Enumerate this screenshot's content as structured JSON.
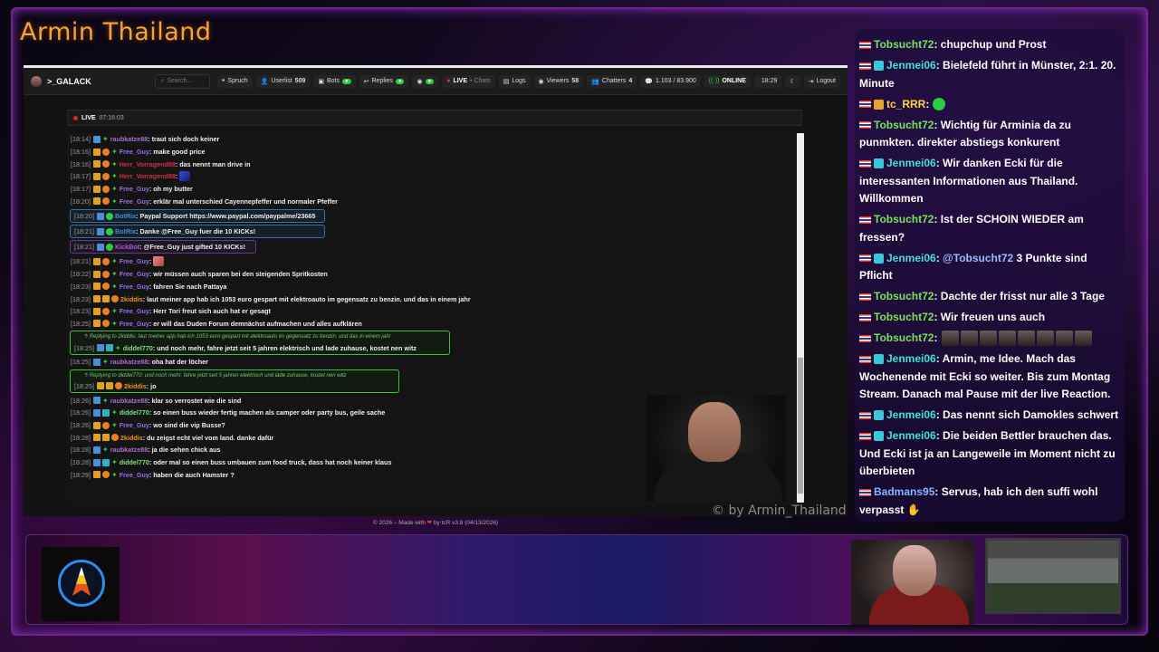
{
  "channel_title": "Armin Thailand",
  "app": {
    "brand": ">_GALACK",
    "search_placeholder": "Search...",
    "toolbar": [
      {
        "icon": "quote-icon",
        "label": "Spruch"
      },
      {
        "icon": "user-icon",
        "label": "Userlist",
        "count": "509"
      },
      {
        "icon": "robot-icon",
        "label": "Bots",
        "pill": "on"
      },
      {
        "icon": "reply-icon",
        "label": "Replies",
        "pill": "on"
      },
      {
        "icon": "ghost-icon",
        "label": "",
        "pill": "on"
      },
      {
        "icon": "live-dot-icon",
        "label": "LIVE",
        "sub": "• Chats"
      },
      {
        "icon": "file-icon",
        "label": "Logs"
      },
      {
        "icon": "eye-icon",
        "label": "Viewers",
        "count": "58"
      },
      {
        "icon": "users-icon",
        "label": "Chatters",
        "count": "4"
      },
      {
        "icon": "chat-icon",
        "label": "1.103 / 83.900"
      },
      {
        "icon": "signal-icon",
        "label": "ONLINE"
      },
      {
        "icon": "clock-icon",
        "label": "18:29"
      },
      {
        "icon": "moon-icon",
        "label": ""
      },
      {
        "icon": "logout-icon",
        "label": "Logout"
      }
    ],
    "live_label": "LIVE",
    "live_time": "07:16:03",
    "footer": "© 2026 – Made with",
    "footer_by": "by tcR",
    "footer_version": "v3.8 (04/13/2026)"
  },
  "messages": [
    {
      "t": "[18:14]",
      "user": "raubkatze88",
      "cls": "u-raub",
      "badges": [
        "blue",
        "green"
      ],
      "text": ": traut sich doch keiner"
    },
    {
      "t": "[18:16]",
      "user": "Free_Guy",
      "cls": "u-free",
      "badges": [
        "gold",
        "org",
        "green"
      ],
      "text": ": make good price"
    },
    {
      "t": "[18:16]",
      "user": "Herr_Vorragend88",
      "cls": "u-herr",
      "badges": [
        "gold",
        "org",
        "green"
      ],
      "text": ": das nennt man drive in"
    },
    {
      "t": "[18:17]",
      "user": "Herr_Vorragend88",
      "cls": "u-herr",
      "badges": [
        "gold",
        "org",
        "green"
      ],
      "text": ":",
      "emote": "blue"
    },
    {
      "t": "[18:17]",
      "user": "Free_Guy",
      "cls": "u-free",
      "badges": [
        "gold",
        "org",
        "green"
      ],
      "text": ": oh my butter"
    },
    {
      "t": "[18:20]",
      "user": "Free_Guy",
      "cls": "u-free",
      "badges": [
        "gold",
        "org",
        "green"
      ],
      "text": ": erklär mal unterschied Cayennepfeffer und normaler Pfeffer"
    },
    {
      "t": "[18:20]",
      "user": "BotRix",
      "cls": "u-bot",
      "badges": [
        "blue",
        "bot"
      ],
      "text": ": Paypal Support https://www.paypal.com/paypalme/23665",
      "box": "bot"
    },
    {
      "t": "[18:21]",
      "user": "BotRix",
      "cls": "u-bot",
      "badges": [
        "blue",
        "bot"
      ],
      "text": ": Danke @Free_Guy fuer die 10 KICKs!",
      "box": "bot"
    },
    {
      "t": "[18:21]",
      "user": "KickBot",
      "cls": "u-kick",
      "badges": [
        "blue",
        "bot"
      ],
      "text": ": @Free_Guy just gifted 10 KICKs!",
      "box": "kick"
    },
    {
      "t": "[18:21]",
      "user": "Free_Guy",
      "cls": "u-free",
      "badges": [
        "gold",
        "org",
        "green"
      ],
      "text": ":",
      "emote": "pink"
    },
    {
      "t": "[18:22]",
      "user": "Free_Guy",
      "cls": "u-free",
      "badges": [
        "gold",
        "org",
        "green"
      ],
      "text": ": wir müssen auch sparen bei den steigenden Spritkosten"
    },
    {
      "t": "[18:23]",
      "user": "Free_Guy",
      "cls": "u-free",
      "badges": [
        "gold",
        "org",
        "green"
      ],
      "text": ": fahren Sie nach Pattaya"
    },
    {
      "t": "[18:23]",
      "user": "2kiddis",
      "cls": "u-2k",
      "badges": [
        "gold",
        "gold",
        "org"
      ],
      "text": ": laut meiner app hab ich 1053 euro gespart mit elektroauto im gegensatz zu benzin. und das in einem jahr"
    },
    {
      "t": "[18:23]",
      "user": "Free_Guy",
      "cls": "u-free",
      "badges": [
        "gold",
        "org",
        "green"
      ],
      "text": ": Herr Tori freut sich auch hat er gesagt"
    },
    {
      "t": "[18:25]",
      "user": "Free_Guy",
      "cls": "u-free",
      "badges": [
        "gold",
        "org",
        "green"
      ],
      "text": ": er will das Duden Forum demnächst aufmachen und alles aufklären"
    },
    {
      "t": "[18:25]",
      "user": "diddel770",
      "cls": "u-did",
      "badges": [
        "blue",
        "cyan",
        "green"
      ],
      "text": ": und noch mehr, fahre jetzt seit 5 jahren elektrisch und lade zuhause, kostet nen witz",
      "reply": "Replying to 2kiddis: laut meiner app hab ich 1053 euro gespart mit elektroauto im gegensatz zu benzin. und das in einem jahr",
      "rw": 420
    },
    {
      "t": "[18:25]",
      "user": "raubkatze88",
      "cls": "u-raub",
      "badges": [
        "blue",
        "green"
      ],
      "text": ": oha hat der löcher"
    },
    {
      "t": "[18:25]",
      "user": "2kiddis",
      "cls": "u-2k",
      "badges": [
        "gold",
        "gold",
        "org"
      ],
      "text": ": jo",
      "reply": "Replying to diddel770: und noch mehr, fahre jetzt seit 5 jahren elektrisch und lade zuhause, kostet nen witz",
      "rw": 364
    },
    {
      "t": "[18:26]",
      "user": "raubkatze88",
      "cls": "u-raub",
      "badges": [
        "blue",
        "green"
      ],
      "text": ": klar so verrostet wie die sind"
    },
    {
      "t": "[18:26]",
      "user": "diddel770",
      "cls": "u-did",
      "badges": [
        "blue",
        "cyan",
        "green"
      ],
      "text": ": so einen buss wieder fertig machen als camper oder party bus, geile sache"
    },
    {
      "t": "[18:26]",
      "user": "Free_Guy",
      "cls": "u-free",
      "badges": [
        "gold",
        "org",
        "green"
      ],
      "text": ": wo sind die vip Busse?"
    },
    {
      "t": "[18:28]",
      "user": "2kiddis",
      "cls": "u-2k",
      "badges": [
        "gold",
        "gold",
        "org"
      ],
      "text": ": du zeigst echt viel vom land. danke dafür"
    },
    {
      "t": "[18:28]",
      "user": "raubkatze88",
      "cls": "u-raub",
      "badges": [
        "blue",
        "green"
      ],
      "text": ": ja die sehen chick aus"
    },
    {
      "t": "[18:28]",
      "user": "diddel770",
      "cls": "u-did",
      "badges": [
        "blue",
        "cyan",
        "green"
      ],
      "text": ": oder mal so einen buss umbauen zum food truck, dass hat noch keiner klaus"
    },
    {
      "t": "[18:29]",
      "user": "Free_Guy",
      "cls": "u-free",
      "badges": [
        "gold",
        "org",
        "green"
      ],
      "text": ": haben die auch Hamster ?"
    }
  ],
  "watermark": "© by Armin_Thailand",
  "side_chat": [
    {
      "badge": "",
      "name": "Tobsucht72",
      "cls": "sn-g",
      "text": ": chupchup und Prost"
    },
    {
      "badge": "cyan",
      "name": "Jenmei06",
      "cls": "sn-c",
      "text": ": Bielefeld führt in Münster, 2:1. 20. Minute"
    },
    {
      "badge": "gold",
      "name": "tc_RRR",
      "cls": "sn-y",
      "text": ":",
      "green": true
    },
    {
      "badge": "",
      "name": "Tobsucht72",
      "cls": "sn-g",
      "text": ": Wichtig für Arminia da zu punmkten. direkter abstiegs konkurent"
    },
    {
      "badge": "cyan",
      "name": "Jenmei06",
      "cls": "sn-c",
      "text": ": Wir danken Ecki für die interessanten Informationen aus Thailand. Willkommen"
    },
    {
      "badge": "",
      "name": "Tobsucht72",
      "cls": "sn-g",
      "text": ": Ist der SCHOIN WIEDER am fressen?"
    },
    {
      "badge": "cyan",
      "name": "Jenmei06",
      "cls": "sn-c",
      "text": ": ",
      "mention": "@Tobsucht72",
      "text2": " 3 Punkte sind Pflicht"
    },
    {
      "badge": "",
      "name": "Tobsucht72",
      "cls": "sn-g",
      "text": ": Dachte der frisst nur alle 3 Tage"
    },
    {
      "badge": "",
      "name": "Tobsucht72",
      "cls": "sn-g",
      "text": ": Wir freuen uns auch"
    },
    {
      "badge": "",
      "name": "Tobsucht72",
      "cls": "sn-g",
      "text": ":",
      "emotes": 8
    },
    {
      "badge": "cyan",
      "name": "Jenmei06",
      "cls": "sn-c",
      "text": ": Armin, me Idee. Mach das Wochenende mit Ecki so weiter. Bis zum Montag Stream. Danach mal Pause mit der live Reaction."
    },
    {
      "badge": "cyan",
      "name": "Jenmei06",
      "cls": "sn-c",
      "text": ": Das nennt sich Damokles schwert"
    },
    {
      "badge": "cyan",
      "name": "Jenmei06",
      "cls": "sn-c",
      "text": ": Die beiden Bettler brauchen das. Und Ecki ist ja an Langeweile im Moment nicht zu überbieten"
    },
    {
      "badge": "",
      "name": "Badmans95",
      "cls": "sn-b",
      "text": ": Servus, hab ich den suffi wohl verpasst",
      "wave": true
    }
  ]
}
